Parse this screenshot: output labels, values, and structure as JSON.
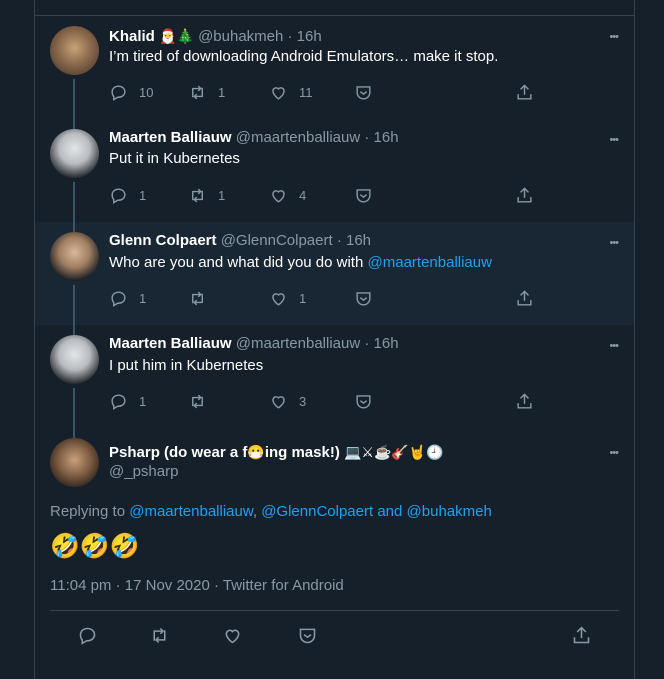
{
  "colors": {
    "bg": "#15202b",
    "highlight": "#192734",
    "text": "#ffffff",
    "muted": "#8899a6",
    "link": "#1da1f2",
    "border": "#38444d"
  },
  "more_label": "•••",
  "tweets": [
    {
      "name": "Khalid",
      "name_emojis": "🎅🎄",
      "handle": "@buhakmeh",
      "time": "· 16h",
      "text": "I’m tired of downloading Android Emulators… make it stop.",
      "replies": "10",
      "retweets": "1",
      "likes": "11"
    },
    {
      "name": "Maarten Balliauw",
      "handle": "@maartenballiauw",
      "time": "· 16h",
      "text": "Put it in Kubernetes",
      "replies": "1",
      "retweets": "1",
      "likes": "4"
    },
    {
      "name": "Glenn Colpaert",
      "handle": "@GlennColpaert",
      "time": "· 16h",
      "text": "Who are you and what did you do with ",
      "mention": "@maartenballiauw",
      "replies": "1",
      "retweets": "",
      "likes": "1"
    },
    {
      "name": "Maarten Balliauw",
      "handle": "@maartenballiauw",
      "time": "· 16h",
      "text": "I put him in Kubernetes",
      "replies": "1",
      "retweets": "",
      "likes": "3"
    }
  ],
  "focused": {
    "name_part1": "Psharp (do wear a f",
    "name_emoji": "😷",
    "name_part2": "ing mask!)",
    "name_emojis_after": "💻⚔☕🎸🤘🕘",
    "handle": "@_psharp",
    "replying_prefix": "Replying to",
    "replying_to_1": "@maartenballiauw",
    "replying_sep": ",",
    "replying_to_2": "@GlennColpaert",
    "replying_and": "and",
    "replying_to_3": "@buhakmeh",
    "text": "🤣🤣🤣",
    "timestamp": "11:04 pm · 17 Nov 2020 · Twitter for Android"
  }
}
